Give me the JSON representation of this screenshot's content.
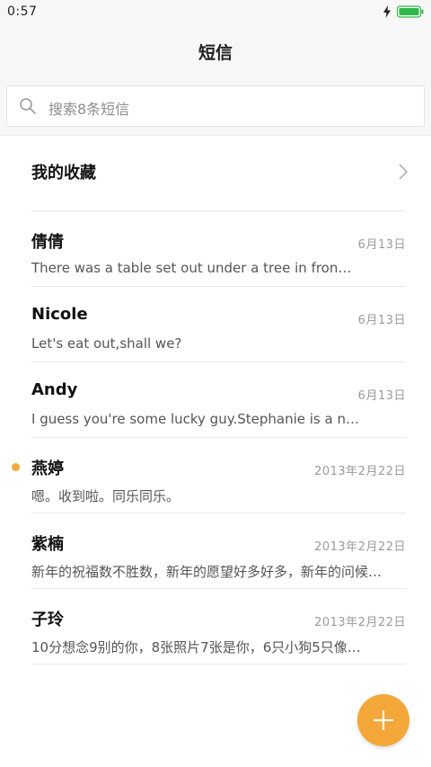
{
  "status_bar": {
    "time": "0:57",
    "charging_icon": "bolt-icon",
    "battery_icon": "battery-full-icon",
    "battery_color": "#2fb84a"
  },
  "header": {
    "title": "短信"
  },
  "search": {
    "placeholder": "搜索8条短信",
    "icon": "search-icon"
  },
  "favorites": {
    "label": "我的收藏",
    "icon": "chevron-right-icon"
  },
  "conversations": [
    {
      "name": "倩倩",
      "date": "6月13日",
      "preview": "There was a table set out under a tree in fron…",
      "unread": false
    },
    {
      "name": "Nicole",
      "date": "6月13日",
      "preview": "Let's eat out,shall we?",
      "unread": false
    },
    {
      "name": "Andy",
      "date": "6月13日",
      "preview": "I guess you're some lucky guy.Stephanie is a n…",
      "unread": false
    },
    {
      "name": "燕婷",
      "date": "2013年2月22日",
      "preview": "嗯。收到啦。同乐同乐。",
      "unread": true
    },
    {
      "name": "紫楠",
      "date": "2013年2月22日",
      "preview": "新年的祝福数不胜数，新年的愿望好多好多，新年的问候…",
      "unread": false
    },
    {
      "name": "子玲",
      "date": "2013年2月22日",
      "preview": "10分想念9别的你，8张照片7张是你，6只小狗5只像…",
      "unread": false
    }
  ],
  "fab": {
    "icon": "plus-icon",
    "color": "#f4a83a"
  },
  "colors": {
    "accent": "#f4a83a",
    "background": "#f7f7f7"
  }
}
